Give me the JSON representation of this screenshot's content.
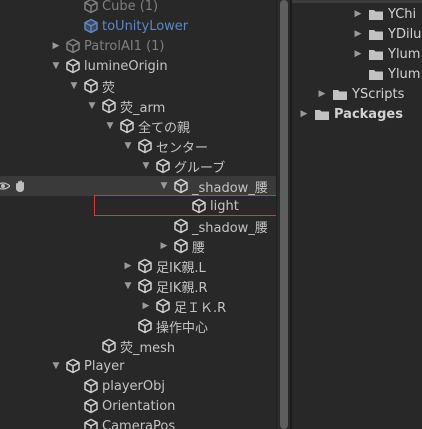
{
  "hierarchy": {
    "rows": [
      {
        "label": "Cube (1)",
        "indent": 1,
        "foldout": "none",
        "style": "dim",
        "icon": "cube-icon"
      },
      {
        "label": "toUnityLower",
        "indent": 1,
        "foldout": "none",
        "style": "prefab",
        "icon": "prefab-cube-icon"
      },
      {
        "label": "PatrolAI1 (1)",
        "indent": 0,
        "foldout": "collapsed",
        "style": "dim",
        "icon": "cube-icon"
      },
      {
        "label": "lumineOrigin",
        "indent": 0,
        "foldout": "expanded",
        "style": "normal",
        "icon": "cube-icon"
      },
      {
        "label": "荧",
        "indent": 1,
        "foldout": "expanded",
        "style": "normal",
        "icon": "cube-icon"
      },
      {
        "label": "荧_arm",
        "indent": 2,
        "foldout": "expanded",
        "style": "normal",
        "icon": "cube-icon"
      },
      {
        "label": "全ての親",
        "indent": 3,
        "foldout": "expanded",
        "style": "normal",
        "icon": "cube-icon"
      },
      {
        "label": "センター",
        "indent": 4,
        "foldout": "expanded",
        "style": "normal",
        "icon": "cube-icon"
      },
      {
        "label": "グルーブ",
        "indent": 5,
        "foldout": "expanded",
        "style": "normal",
        "icon": "cube-icon"
      },
      {
        "label": "_shadow_腰",
        "indent": 6,
        "foldout": "expanded",
        "style": "normal",
        "icon": "cube-icon",
        "hover": true
      },
      {
        "label": "light",
        "indent": 7,
        "foldout": "none",
        "style": "normal",
        "icon": "cube-icon",
        "boxed": true
      },
      {
        "label": "_shadow_腰",
        "indent": 6,
        "foldout": "none",
        "style": "normal",
        "icon": "cube-icon"
      },
      {
        "label": "腰",
        "indent": 6,
        "foldout": "collapsed",
        "style": "normal",
        "icon": "cube-icon"
      },
      {
        "label": "足IK親.L",
        "indent": 4,
        "foldout": "collapsed",
        "style": "normal",
        "icon": "cube-icon"
      },
      {
        "label": "足IK親.R",
        "indent": 4,
        "foldout": "expanded",
        "style": "normal",
        "icon": "cube-icon"
      },
      {
        "label": "足ＩＫ.R",
        "indent": 5,
        "foldout": "collapsed",
        "style": "normal",
        "icon": "cube-icon"
      },
      {
        "label": "操作中心",
        "indent": 4,
        "foldout": "none",
        "style": "normal",
        "icon": "cube-icon"
      },
      {
        "label": "荧_mesh",
        "indent": 2,
        "foldout": "none",
        "style": "normal",
        "icon": "cube-icon"
      },
      {
        "label": "Player",
        "indent": 0,
        "foldout": "expanded",
        "style": "normal",
        "icon": "cube-icon"
      },
      {
        "label": "playerObj",
        "indent": 1,
        "foldout": "none",
        "style": "normal",
        "icon": "cube-icon"
      },
      {
        "label": "Orientation",
        "indent": 1,
        "foldout": "none",
        "style": "normal",
        "icon": "cube-icon"
      },
      {
        "label": "CameraPos",
        "indent": 1,
        "foldout": "none",
        "style": "normal",
        "icon": "cube-icon"
      }
    ]
  },
  "project": {
    "rows": [
      {
        "label": "YChi",
        "indent": 3,
        "foldout": "collapsed",
        "bold": false,
        "icon": "folder-icon"
      },
      {
        "label": "YDilu",
        "indent": 3,
        "foldout": "collapsed",
        "bold": false,
        "icon": "folder-icon"
      },
      {
        "label": "Ylum",
        "indent": 3,
        "foldout": "collapsed",
        "bold": false,
        "icon": "folder-icon"
      },
      {
        "label": "Ylum",
        "indent": 3,
        "foldout": "none",
        "bold": false,
        "icon": "folder-icon"
      },
      {
        "label": "YScripts",
        "indent": 1,
        "foldout": "collapsed",
        "bold": false,
        "icon": "folder-icon"
      },
      {
        "label": "Packages",
        "indent": 0,
        "foldout": "collapsed",
        "bold": true,
        "icon": "folder-icon"
      }
    ]
  },
  "colors": {
    "background": "#282828",
    "text": "#c4c4c4",
    "dim_text": "#7f7f7f",
    "prefab_text": "#5f86c2",
    "hover_row": "#3a3a3a",
    "highlight_box": "#d33a3a"
  }
}
